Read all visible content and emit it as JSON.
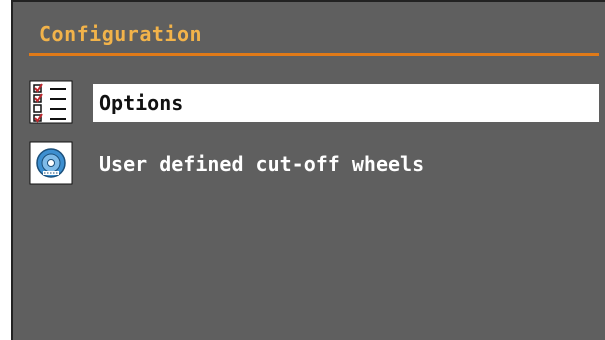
{
  "screen": {
    "title": "Configuration",
    "accent_color": "#e07a18",
    "title_color": "#f2b34a",
    "background_color": "#5f5f5f"
  },
  "menu": {
    "items": [
      {
        "label": "Options",
        "icon": "checklist-icon",
        "selected": true
      },
      {
        "label": "User defined cut-off wheels",
        "icon": "cutoff-wheel-icon",
        "selected": false
      }
    ]
  }
}
